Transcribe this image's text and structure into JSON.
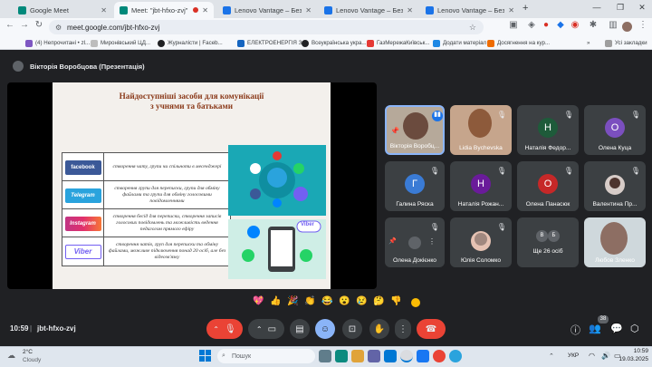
{
  "browser": {
    "tabs": [
      {
        "label": "Google Meet",
        "active": false
      },
      {
        "label": "Meet: \"jbt-hfxo-zvj\"",
        "active": true
      },
      {
        "label": "Lenovo Vantage – Безкоштовн",
        "active": false
      },
      {
        "label": "Lenovo Vantage – Безкоштовн",
        "active": false
      },
      {
        "label": "Lenovo Vantage – Безкоштовн",
        "active": false
      }
    ],
    "url": "meet.google.com/jbt-hfxo-zvj",
    "bookmarks": [
      "(4) Непрочитані • zl...",
      "Миронівський ЦД...",
      "Журналісти | Faceb...",
      "ЕЛЕКТРОЕНЕРГІЯ З...",
      "Всеукраїнська укра...",
      "ГазМережаКиївськ...",
      "Додати матеріал",
      "Досягнення на кур..."
    ],
    "all_bookmarks": "Усі закладки"
  },
  "meet": {
    "presenter": "Вікторія Воробцова (Презентація)",
    "time": "10:59",
    "meeting_code": "jbt-hfxo-zvj",
    "participants_count": "38",
    "slide": {
      "title_line1": "Найдоступніші засоби для комунікації",
      "title_line2": "з учнями та батьками",
      "rows": [
        {
          "logo": "facebook",
          "text": "створення чату, групи чи спільноти в месенджері"
        },
        {
          "logo": "Telegram",
          "text": "створення групи для переписки, групи для обміну файлами та групи для обміну голосовими повідомленнями"
        },
        {
          "logo": "Instagram",
          "text": "створення бесід для переписки, створення записів голосових повідомлень та можливість ведення педагогом прямого ефіру"
        },
        {
          "logo": "Viber",
          "text": "створення чатів, груп для переписки та обміну файлами, можливе підключення понад 20 осіб, але без відеозв'язку"
        }
      ],
      "viber_label": "Viber"
    },
    "participants": [
      {
        "name": "Вікторія Воробц...",
        "type": "video"
      },
      {
        "name": "Lidia Bychevska",
        "type": "video"
      },
      {
        "name": "Наталія Федор...",
        "initial": "Н",
        "color": "#1e5b3a"
      },
      {
        "name": "Олена Куца",
        "initial": "О",
        "color": "#7b4fbf"
      },
      {
        "name": "Галина Ряска",
        "initial": "Г",
        "color": "#3a7bd5"
      },
      {
        "name": "Наталія Рожан...",
        "initial": "Н",
        "color": "#6a1b9a"
      },
      {
        "name": "Олена Панасюк",
        "initial": "О",
        "color": "#c62828"
      },
      {
        "name": "Валентина Пр...",
        "type": "avatar"
      },
      {
        "name": "Олена Докієнко",
        "type": "pinned"
      },
      {
        "name": "Юлія Соломко",
        "type": "avatar"
      },
      {
        "name": "Ще 26 осіб",
        "type": "more",
        "mini": [
          "В",
          "Б"
        ]
      },
      {
        "name": "Любов Зленко",
        "type": "video"
      }
    ],
    "emojis": [
      "💖",
      "👍",
      "🎉",
      "👏",
      "😂",
      "😮",
      "😢",
      "🤔",
      "👎"
    ]
  },
  "taskbar": {
    "weather_temp": "2°C",
    "weather_desc": "Cloudy",
    "search_placeholder": "Пошук",
    "lang": "УКР",
    "clock_time": "10:59",
    "clock_date": "19.03.2025"
  }
}
